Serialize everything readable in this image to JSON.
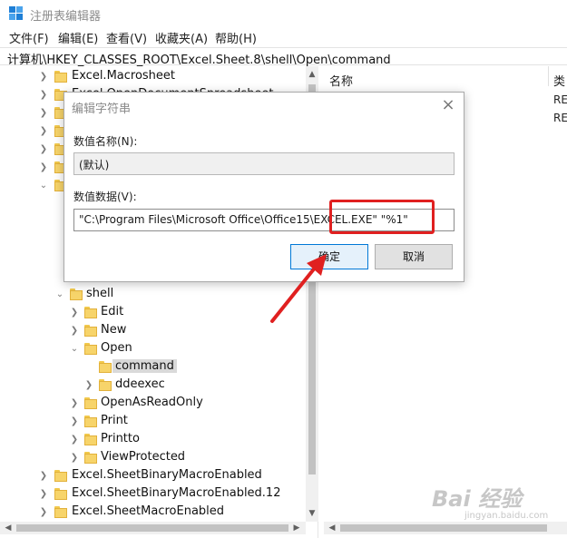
{
  "window": {
    "title": "注册表编辑器",
    "app_icon": "registry-icon"
  },
  "menu": [
    {
      "label": "文件(F)"
    },
    {
      "label": "编辑(E)"
    },
    {
      "label": "查看(V)"
    },
    {
      "label": "收藏夹(A)"
    },
    {
      "label": "帮助(H)"
    }
  ],
  "address": {
    "path": "计算机\\HKEY_CLASSES_ROOT\\Excel.Sheet.8\\shell\\Open\\command"
  },
  "tree": {
    "items": [
      {
        "label": "Excel.Macrosheet"
      },
      {
        "label": "Excel.OpenDocumentSpreadsheet"
      },
      {
        "label": "shell"
      },
      {
        "label": "Edit"
      },
      {
        "label": "New"
      },
      {
        "label": "Open"
      },
      {
        "label": "command"
      },
      {
        "label": "ddeexec"
      },
      {
        "label": "OpenAsReadOnly"
      },
      {
        "label": "Print"
      },
      {
        "label": "Printto"
      },
      {
        "label": "ViewProtected"
      },
      {
        "label": "Excel.SheetBinaryMacroEnabled"
      },
      {
        "label": "Excel.SheetBinaryMacroEnabled.12"
      },
      {
        "label": "Excel.SheetMacroEnabled"
      }
    ]
  },
  "list": {
    "headers": {
      "name": "名称",
      "type": "类"
    },
    "rows": [
      {
        "type": "RE"
      },
      {
        "type": "RE"
      }
    ]
  },
  "dialog": {
    "title": "编辑字符串",
    "name_label": "数值名称(N):",
    "name_value": "(默认)",
    "data_label": "数值数据(V):",
    "data_value": "\"C:\\Program Files\\Microsoft Office\\Office15\\EXCEL.EXE\" \"%1\"",
    "ok_label": "确定",
    "cancel_label": "取消"
  },
  "watermark": {
    "main": "Bai 经验",
    "sub": "jingyan.baidu.com"
  },
  "colors": {
    "annotation": "#e02020",
    "folder": "#f7d46a",
    "selection": "#d9d9d9",
    "accent": "#0078d7"
  }
}
